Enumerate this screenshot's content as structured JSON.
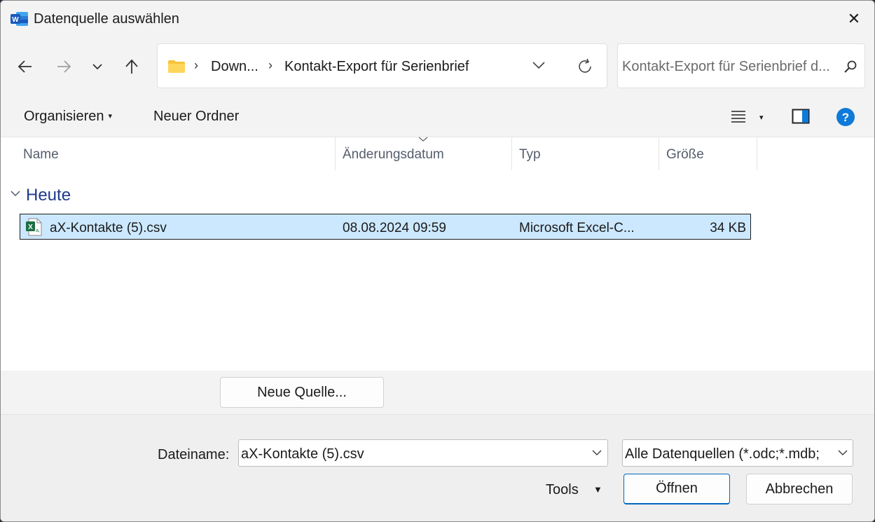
{
  "window": {
    "title": "Datenquelle auswählen",
    "app_icon": "word-icon",
    "close_glyph": "✕"
  },
  "nav": {
    "back_icon": "back-arrow-icon",
    "forward_icon": "forward-arrow-icon",
    "recent_icon": "chevron-down-icon",
    "up_icon": "up-arrow-icon",
    "breadcrumbs": [
      "Down...",
      "Kontakt-Export für Serienbrief"
    ],
    "separator": "›",
    "search_placeholder": "Kontakt-Export für Serienbrief d..."
  },
  "toolbar": {
    "organize_label": "Organisieren",
    "new_folder_label": "Neuer Ordner",
    "dropdown_caret": "▾"
  },
  "columns": [
    "Name",
    "Änderungsdatum",
    "Typ",
    "Größe"
  ],
  "group": {
    "label": "Heute"
  },
  "files": [
    {
      "name": "aX-Kontakte (5).csv",
      "modified": "08.08.2024 09:59",
      "type": "Microsoft Excel-C...",
      "size": "34 KB",
      "icon": "excel-csv-icon",
      "selected": true
    }
  ],
  "footer": {
    "new_source_label": "Neue Quelle...",
    "filename_label": "Dateiname:",
    "filename_value": "aX-Kontakte (5).csv",
    "filter_value": "Alle Datenquellen (*.odc;*.mdb;",
    "tools_label": "Tools",
    "tools_caret": "▼",
    "open_label": "Öffnen",
    "cancel_label": "Abbrechen"
  },
  "colors": {
    "accent": "#0067c0",
    "selection": "#cce8ff",
    "folder": "#f8c33b",
    "excel_green": "#1d6f42",
    "help_blue": "#0f7ad8",
    "group_text": "#1e3a8a"
  }
}
